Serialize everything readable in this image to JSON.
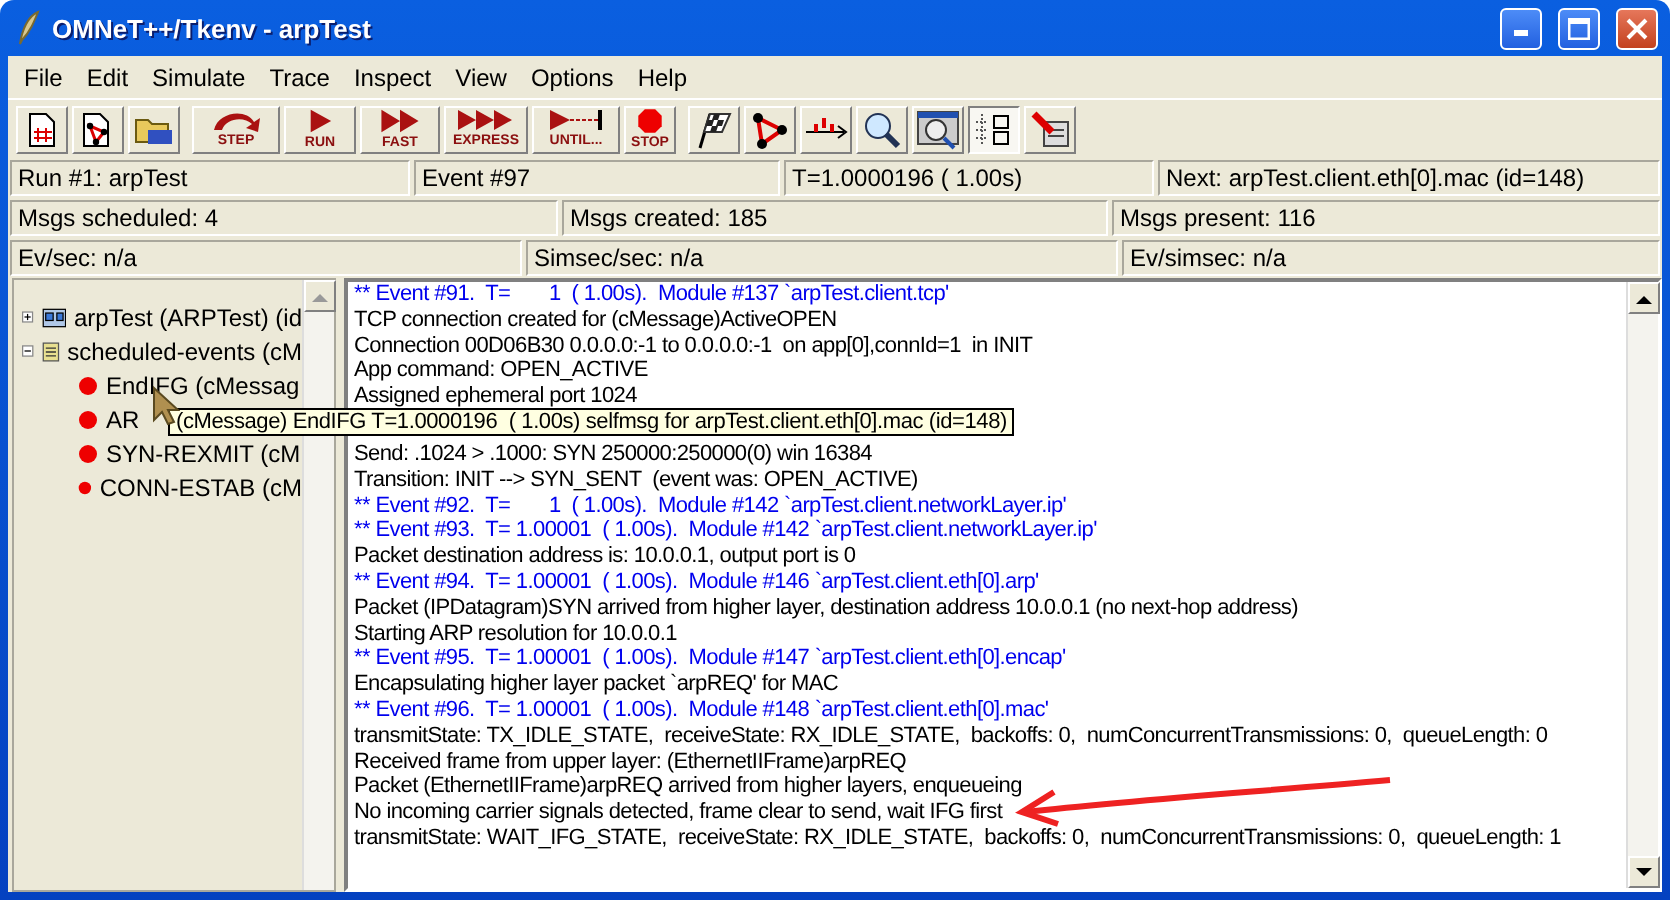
{
  "window": {
    "title": "OMNeT++/Tkenv - arpTest"
  },
  "menu": [
    "File",
    "Edit",
    "Simulate",
    "Trace",
    "Inspect",
    "View",
    "Options",
    "Help"
  ],
  "toolbar": [
    {
      "kind": "newrun",
      "selected": false
    },
    {
      "kind": "loadned",
      "selected": false
    },
    {
      "kind": "open",
      "selected": false
    },
    {
      "kind": "step",
      "label": "STEP",
      "selected": false
    },
    {
      "kind": "run",
      "label": "RUN",
      "selected": false
    },
    {
      "kind": "fast",
      "label": "FAST",
      "selected": false
    },
    {
      "kind": "express",
      "label": "EXPRESS",
      "selected": false
    },
    {
      "kind": "until",
      "label": "UNTIL...",
      "selected": false
    },
    {
      "kind": "stop",
      "label": "STOP",
      "selected": false
    },
    {
      "kind": "finish",
      "selected": false
    },
    {
      "kind": "network",
      "selected": false
    },
    {
      "kind": "timeline",
      "selected": false
    },
    {
      "kind": "find",
      "selected": false
    },
    {
      "kind": "inspect",
      "selected": false
    },
    {
      "kind": "tree",
      "selected": true
    },
    {
      "kind": "options",
      "selected": false
    }
  ],
  "status_rows": [
    [
      "Run #1: arpTest",
      "Event #97",
      "T=1.0000196  ( 1.00s)",
      "Next: arpTest.client.eth[0].mac (id=148)"
    ],
    [
      "Msgs scheduled: 4",
      "Msgs created: 185",
      "Msgs present: 116"
    ],
    [
      "Ev/sec: n/a",
      "Simsec/sec: n/a",
      "Ev/simsec: n/a"
    ]
  ],
  "tree": [
    {
      "label": "arpTest (ARPTest) (id",
      "kind": "module",
      "expanded": false
    },
    {
      "label": "scheduled-events (cM",
      "kind": "queue",
      "expanded": true,
      "children": [
        {
          "label": "EndIFG (cMessag"
        },
        {
          "label": "AR"
        },
        {
          "label": "SYN-REXMIT (cM"
        },
        {
          "label": "CONN-ESTAB (cM"
        }
      ]
    }
  ],
  "tooltip": "(cMessage) EndIFG T=1.0000196  ( 1.00s) selfmsg for arpTest.client.eth[0].mac (id=148)",
  "log": [
    {
      "kind": "event",
      "text": "** Event #91.  T=       1  ( 1.00s).  Module #137 `arpTest.client.tcp'"
    },
    {
      "kind": "text",
      "text": "TCP connection created for (cMessage)ActiveOPEN"
    },
    {
      "kind": "text",
      "text": "Connection 00D06B30 0.0.0.0:-1 to 0.0.0.0:-1  on app[0],connId=1  in INIT"
    },
    {
      "kind": "text",
      "text": "App command: OPEN_ACTIVE"
    },
    {
      "kind": "text",
      "text": "Assigned ephemeral port 1024"
    },
    {
      "kind": "hidden"
    },
    {
      "kind": "text",
      "text": "Send: .1024 > .1000: SYN 250000:250000(0) win 16384"
    },
    {
      "kind": "text",
      "text": "Transition: INIT --> SYN_SENT  (event was: OPEN_ACTIVE)"
    },
    {
      "kind": "event",
      "text": "** Event #92.  T=       1  ( 1.00s).  Module #142 `arpTest.client.networkLayer.ip'"
    },
    {
      "kind": "event",
      "text": "** Event #93.  T= 1.00001  ( 1.00s).  Module #142 `arpTest.client.networkLayer.ip'"
    },
    {
      "kind": "text",
      "text": "Packet destination address is: 10.0.0.1, output port is 0"
    },
    {
      "kind": "event",
      "text": "** Event #94.  T= 1.00001  ( 1.00s).  Module #146 `arpTest.client.eth[0].arp'"
    },
    {
      "kind": "text",
      "text": "Packet (IPDatagram)SYN arrived from higher layer, destination address 10.0.0.1 (no next-hop address)"
    },
    {
      "kind": "text",
      "text": "Starting ARP resolution for 10.0.0.1"
    },
    {
      "kind": "event",
      "text": "** Event #95.  T= 1.00001  ( 1.00s).  Module #147 `arpTest.client.eth[0].encap'"
    },
    {
      "kind": "text",
      "text": "Encapsulating higher layer packet `arpREQ' for MAC"
    },
    {
      "kind": "event",
      "text": "** Event #96.  T= 1.00001  ( 1.00s).  Module #148 `arpTest.client.eth[0].mac'"
    },
    {
      "kind": "text",
      "text": "transmitState: TX_IDLE_STATE,  receiveState: RX_IDLE_STATE,  backoffs: 0,  numConcurrentTransmissions: 0,  queueLength: 0"
    },
    {
      "kind": "text",
      "text": "Received frame from upper layer: (EthernetIIFrame)arpREQ"
    },
    {
      "kind": "text",
      "text": "Packet (EthernetIIFrame)arpREQ arrived from higher layers, enqueueing"
    },
    {
      "kind": "marked",
      "text": "No incoming carrier signals detected, frame clear to send, wait IFG first"
    },
    {
      "kind": "text",
      "text": "transmitState: WAIT_IFG_STATE,  receiveState: RX_IDLE_STATE,  backoffs: 0,  numConcurrentTransmissions: 0,  queueLength: 1"
    }
  ]
}
